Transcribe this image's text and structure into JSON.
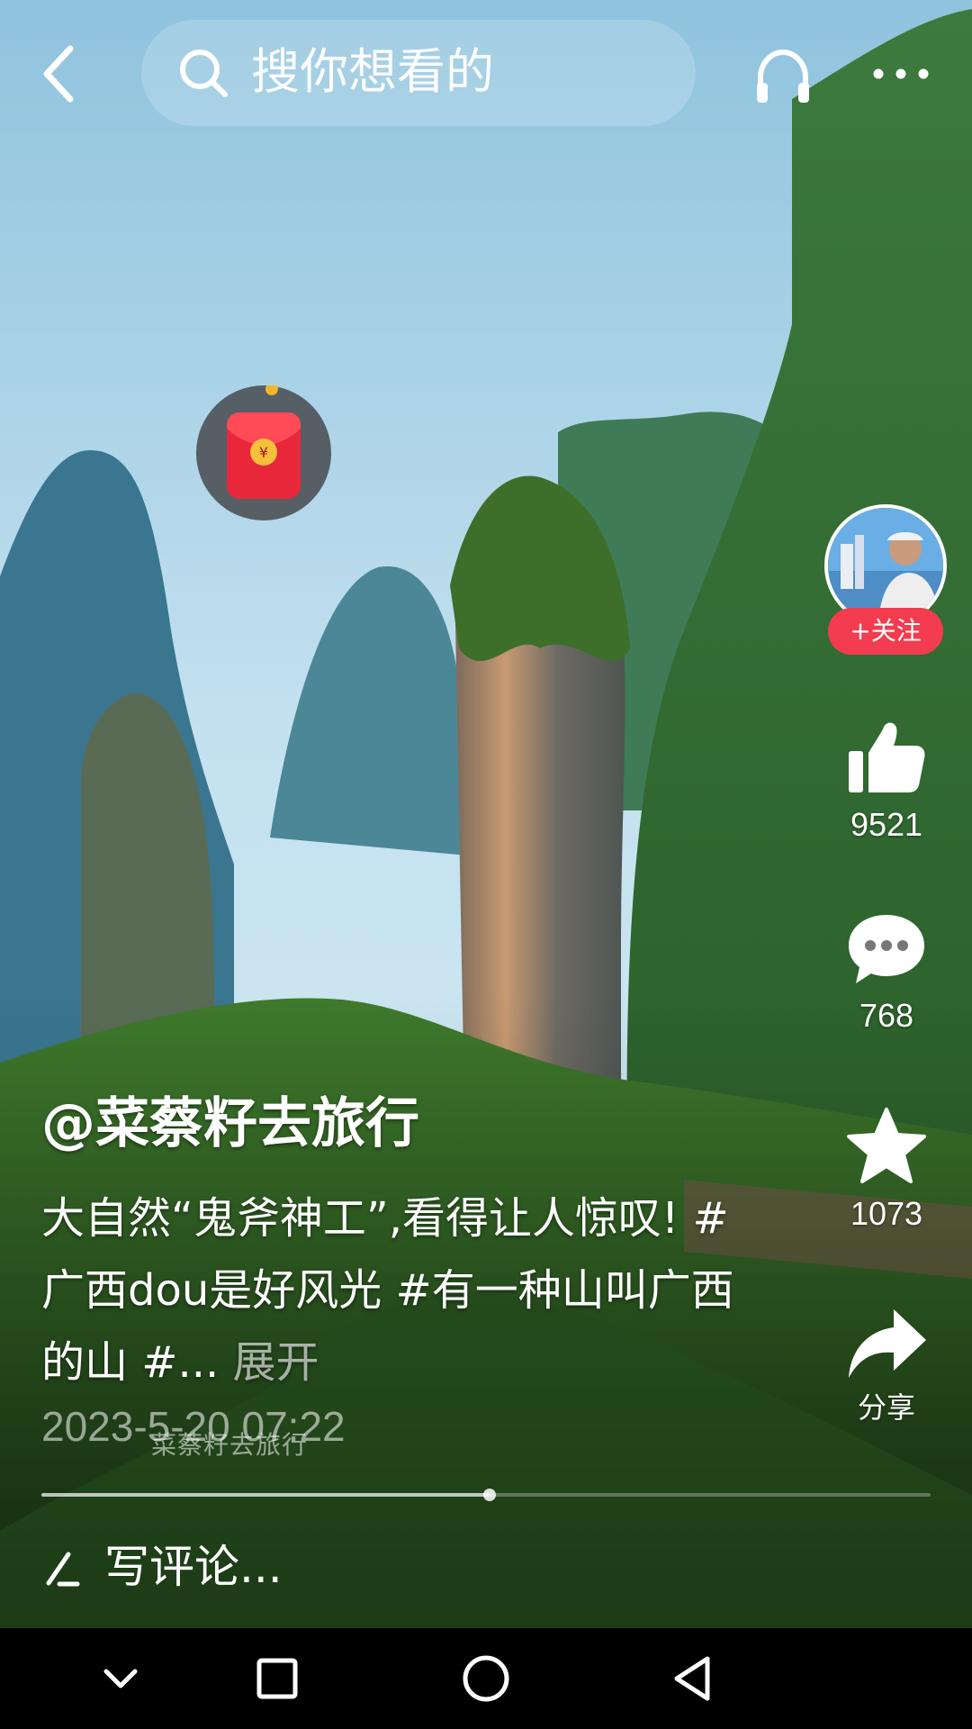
{
  "topbar": {
    "back_icon": "chevron-left-icon",
    "search_icon": "search-icon",
    "search_placeholder": "搜你想看的",
    "headset_icon": "headset-icon",
    "more_icon": "more-dots-icon"
  },
  "red_packet": {
    "icon": "red-envelope-icon",
    "symbol": "¥"
  },
  "author": {
    "handle": "@菜蔡籽去旅行",
    "follow_label": "+关注"
  },
  "rail": {
    "likes": "9521",
    "comments": "768",
    "favorites": "1073",
    "share_label": "分享"
  },
  "post": {
    "caption": "大自然“鬼斧神工”,看得让人惊叹! #广西dou是好风光 #有一种山叫广西的山 #...",
    "expand_label": "展开",
    "date": "2023-5-20 07:22",
    "watermark": "菜蔡籽去旅行"
  },
  "progress": {
    "fraction": 0.504
  },
  "comment": {
    "placeholder": "写评论..."
  },
  "colors": {
    "follow_red": "#f33c4f",
    "packet_red": "#e8283a",
    "nav_bg": "#000000"
  }
}
